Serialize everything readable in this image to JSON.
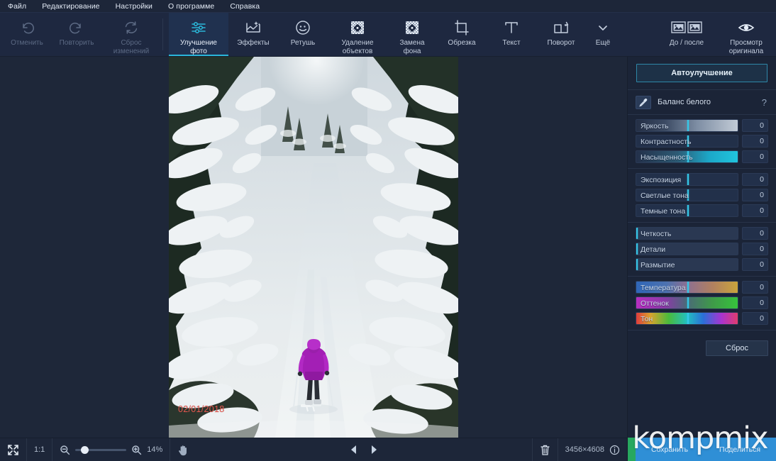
{
  "menubar": {
    "items": [
      {
        "label": "Файл",
        "name": "menu-file"
      },
      {
        "label": "Редактирование",
        "name": "menu-edit"
      },
      {
        "label": "Настройки",
        "name": "menu-settings"
      },
      {
        "label": "О программе",
        "name": "menu-about"
      },
      {
        "label": "Справка",
        "name": "menu-help"
      }
    ]
  },
  "toolbar": {
    "history": [
      {
        "label": "Отменить",
        "icon": "undo-icon",
        "enabled": false
      },
      {
        "label": "Повторить",
        "icon": "redo-icon",
        "enabled": false
      },
      {
        "label": "Сброс\nизменений",
        "icon": "reset-icon",
        "enabled": false
      }
    ],
    "tools": [
      {
        "label": "Улучшение\nфото",
        "icon": "sliders-icon",
        "active": true
      },
      {
        "label": "Эффекты",
        "icon": "effects-icon",
        "active": false
      },
      {
        "label": "Ретушь",
        "icon": "retouch-icon",
        "active": false
      },
      {
        "label": "Удаление\nобъектов",
        "icon": "object-removal-icon",
        "active": false
      },
      {
        "label": "Замена\nфона",
        "icon": "background-change-icon",
        "active": false
      },
      {
        "label": "Обрезка",
        "icon": "crop-icon",
        "active": false
      },
      {
        "label": "Текст",
        "icon": "text-icon",
        "active": false
      },
      {
        "label": "Поворот",
        "icon": "rotate-icon",
        "active": false
      },
      {
        "label": "Ещё",
        "icon": "chevron-down-icon",
        "active": false
      }
    ],
    "view": [
      {
        "label": "До / после",
        "icon": "before-after-icon"
      },
      {
        "label": "Просмотр\nоригинала",
        "icon": "eye-icon"
      }
    ]
  },
  "canvas": {
    "photo_date_stamp": "02/01/2018"
  },
  "panel": {
    "auto_enhance_label": "Автоулучшение",
    "white_balance": {
      "label": "Баланс белого",
      "icon": "eyedropper-icon",
      "help": "?"
    },
    "groups": [
      {
        "name": "tone-group",
        "sliders": [
          {
            "label": "Яркость",
            "value": "0",
            "pos": 50,
            "style": "brightness"
          },
          {
            "label": "Контрастность",
            "value": "0",
            "pos": 50,
            "style": "contrast"
          },
          {
            "label": "Насыщенность",
            "value": "0",
            "pos": 50,
            "style": "saturation"
          }
        ]
      },
      {
        "name": "exposure-group",
        "sliders": [
          {
            "label": "Экспозиция",
            "value": "0",
            "pos": 50,
            "style": "plain"
          },
          {
            "label": "Светлые тона",
            "value": "0",
            "pos": 50,
            "style": "plain"
          },
          {
            "label": "Темные тона",
            "value": "0",
            "pos": 50,
            "style": "plain"
          }
        ]
      },
      {
        "name": "detail-group",
        "sliders": [
          {
            "label": "Четкость",
            "value": "0",
            "pos": 0,
            "style": "plain"
          },
          {
            "label": "Детали",
            "value": "0",
            "pos": 0,
            "style": "plain"
          },
          {
            "label": "Размытие",
            "value": "0",
            "pos": 0,
            "style": "plain"
          }
        ]
      },
      {
        "name": "color-group",
        "sliders": [
          {
            "label": "Температура",
            "value": "0",
            "pos": 50,
            "style": "temperature"
          },
          {
            "label": "Оттенок",
            "value": "0",
            "pos": 50,
            "style": "tint"
          },
          {
            "label": "Тон",
            "value": "0",
            "pos": 50,
            "style": "hue"
          }
        ]
      }
    ],
    "reset_label": "Сброс",
    "save_label": "Сохранить",
    "share_label": "Поделиться"
  },
  "statusbar": {
    "fit_icon": "fit-to-screen-icon",
    "one_to_one": "1:1",
    "zoom_out_icon": "zoom-out-icon",
    "zoom_in_icon": "zoom-in-icon",
    "zoom_level": "14%",
    "hand_icon": "hand-tool-icon",
    "prev_icon": "prev-image-icon",
    "next_icon": "next-image-icon",
    "delete_icon": "trash-icon",
    "dimensions": "3456×4608",
    "info_icon": "info-icon"
  },
  "watermark": {
    "text": "kompmix"
  },
  "colors": {
    "accent": "#2ab6d9",
    "panel_bg": "#1b2437",
    "toolbar_bg": "#1e2840",
    "canvas_bg": "#1e2739",
    "save_green": "#27a85f",
    "save_blue": "#2f8fd6",
    "date_red": "#e0584f"
  }
}
